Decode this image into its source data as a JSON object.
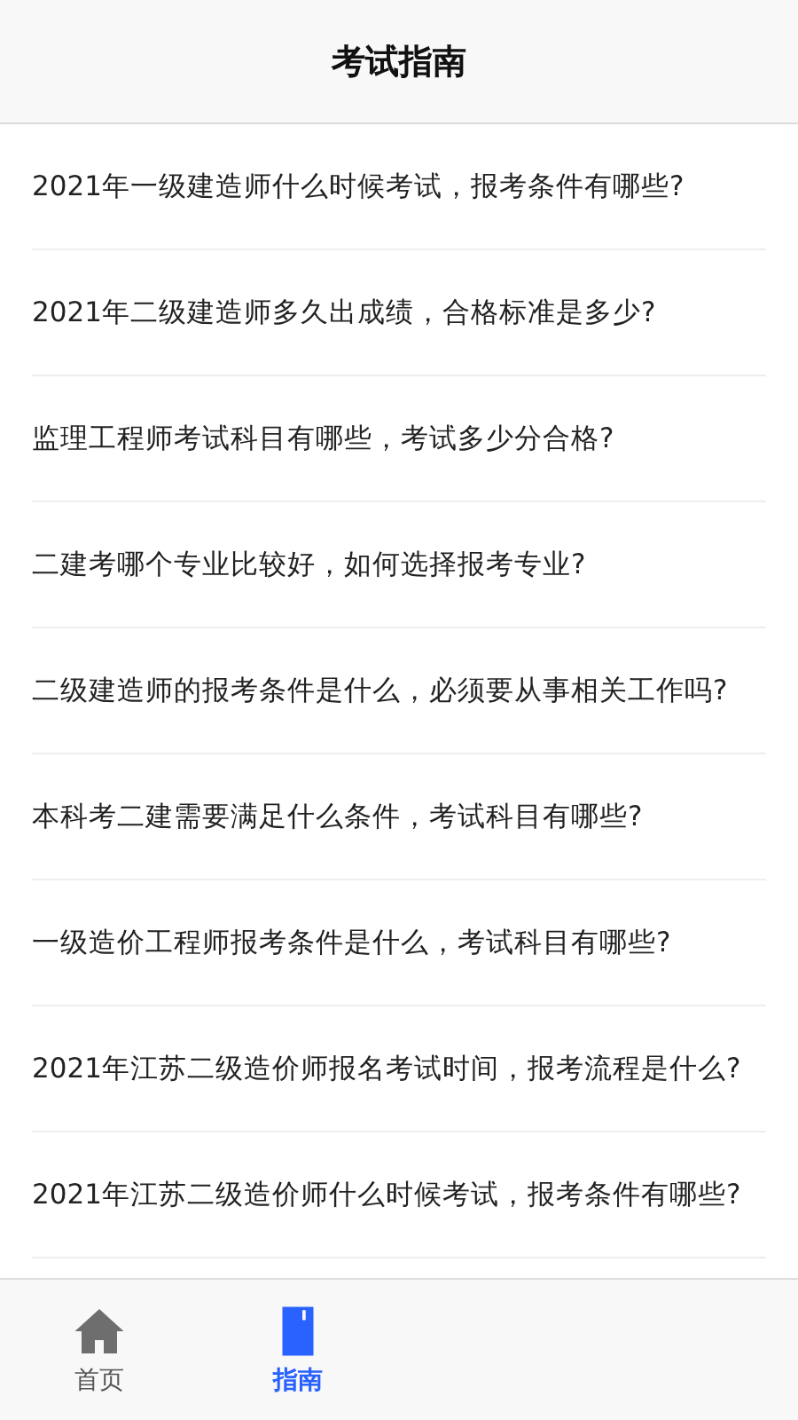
{
  "header": {
    "title": "考试指南"
  },
  "articles": [
    {
      "title": "2021年一级建造师什么时候考试，报考条件有哪些?"
    },
    {
      "title": "2021年二级建造师多久出成绩，合格标准是多少?"
    },
    {
      "title": "监理工程师考试科目有哪些，考试多少分合格?"
    },
    {
      "title": "二建考哪个专业比较好，如何选择报考专业?"
    },
    {
      "title": "二级建造师的报考条件是什么，必须要从事相关工作吗?"
    },
    {
      "title": "本科考二建需要满足什么条件，考试科目有哪些?"
    },
    {
      "title": "一级造价工程师报考条件是什么，考试科目有哪些?"
    },
    {
      "title": "2021年江苏二级造价师报名考试时间，报考流程是什么?"
    },
    {
      "title": "2021年江苏二级造价师什么时候考试，报考条件有哪些?"
    }
  ],
  "tab_bar": [
    {
      "label": "首页",
      "kind": "home",
      "selected": false
    },
    {
      "label": "指南",
      "kind": "guide",
      "selected": true
    }
  ]
}
